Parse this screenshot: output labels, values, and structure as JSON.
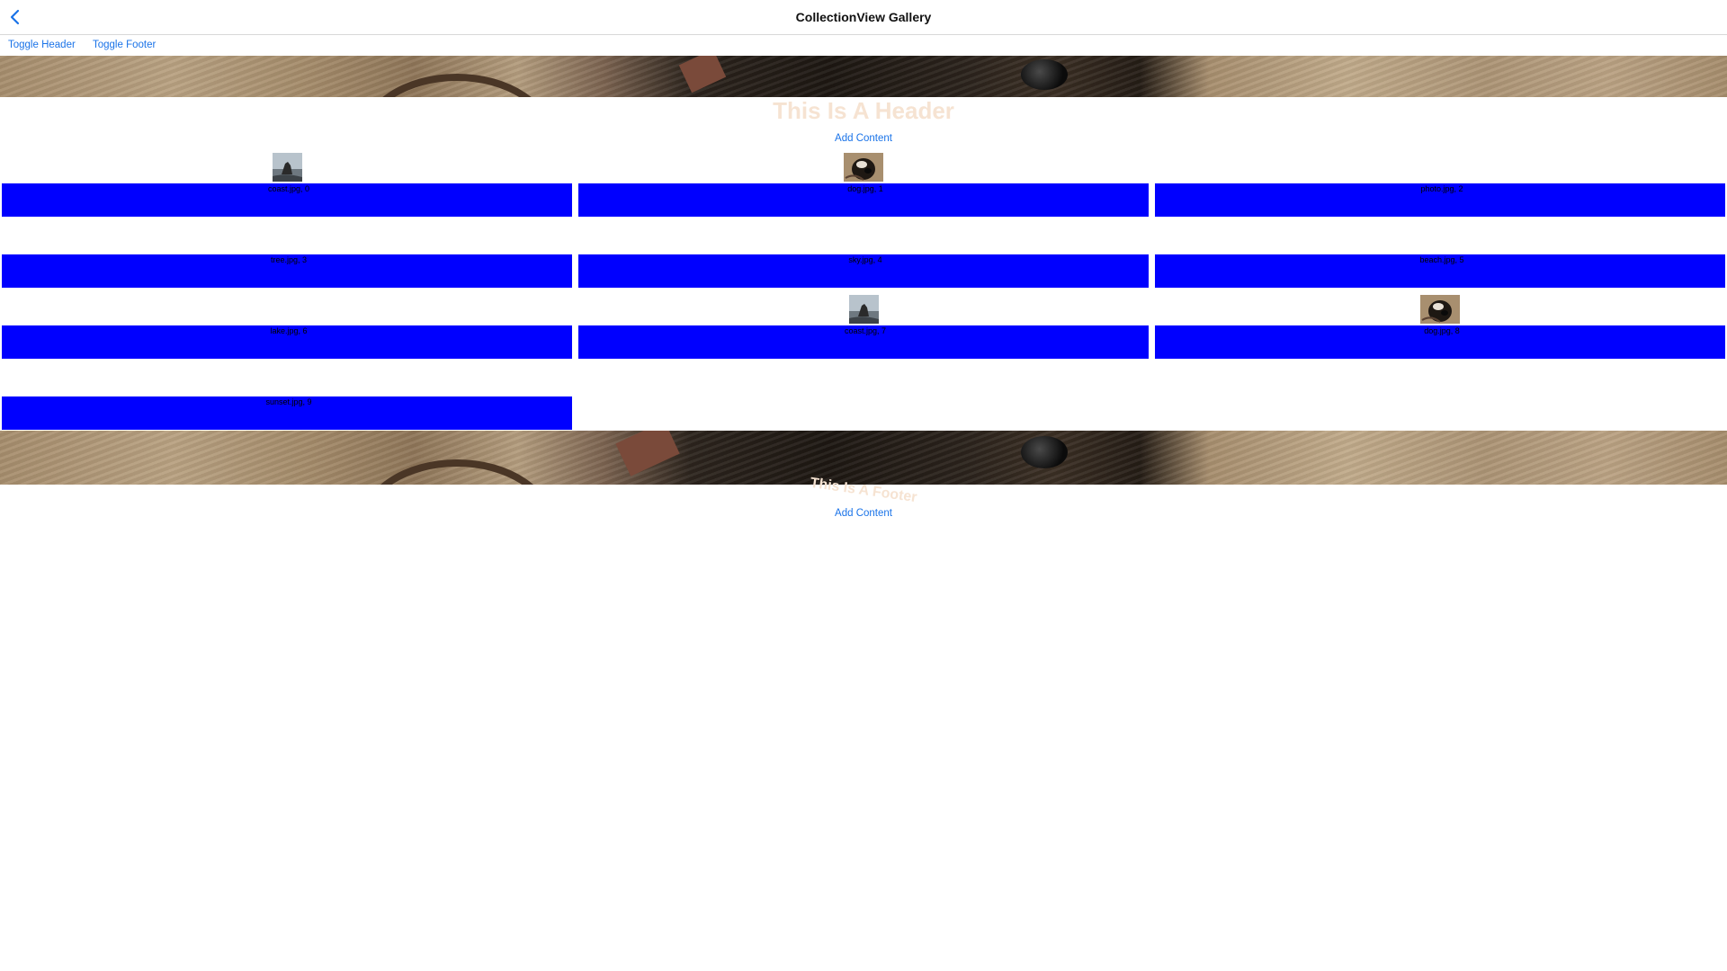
{
  "nav": {
    "title": "CollectionView Gallery",
    "back_icon": "chevron-left-icon"
  },
  "toolbar": {
    "toggle_header": "Toggle Header",
    "toggle_footer": "Toggle Footer"
  },
  "header": {
    "title": "This Is A Header",
    "add_content": "Add Content"
  },
  "footer": {
    "title": "This Is A Footer",
    "add_content": "Add Content"
  },
  "gallery": {
    "items": [
      {
        "label": "coast.jpg, 0",
        "thumbnail": "coast"
      },
      {
        "label": "dog.jpg, 1",
        "thumbnail": "dog"
      },
      {
        "label": "photo.jpg, 2",
        "thumbnail": "none"
      },
      {
        "label": "tree.jpg, 3",
        "thumbnail": "none"
      },
      {
        "label": "sky.jpg, 4",
        "thumbnail": "none"
      },
      {
        "label": "beach.jpg, 5",
        "thumbnail": "none"
      },
      {
        "label": "lake.jpg, 6",
        "thumbnail": "none"
      },
      {
        "label": "coast.jpg, 7",
        "thumbnail": "coast"
      },
      {
        "label": "dog.jpg, 8",
        "thumbnail": "dog"
      },
      {
        "label": "sunset.jpg, 9",
        "thumbnail": "none"
      }
    ]
  },
  "colors": {
    "accent": "#1a73e8",
    "cell_fill": "#0000ff",
    "overlay_title": "#f6e3d2"
  }
}
